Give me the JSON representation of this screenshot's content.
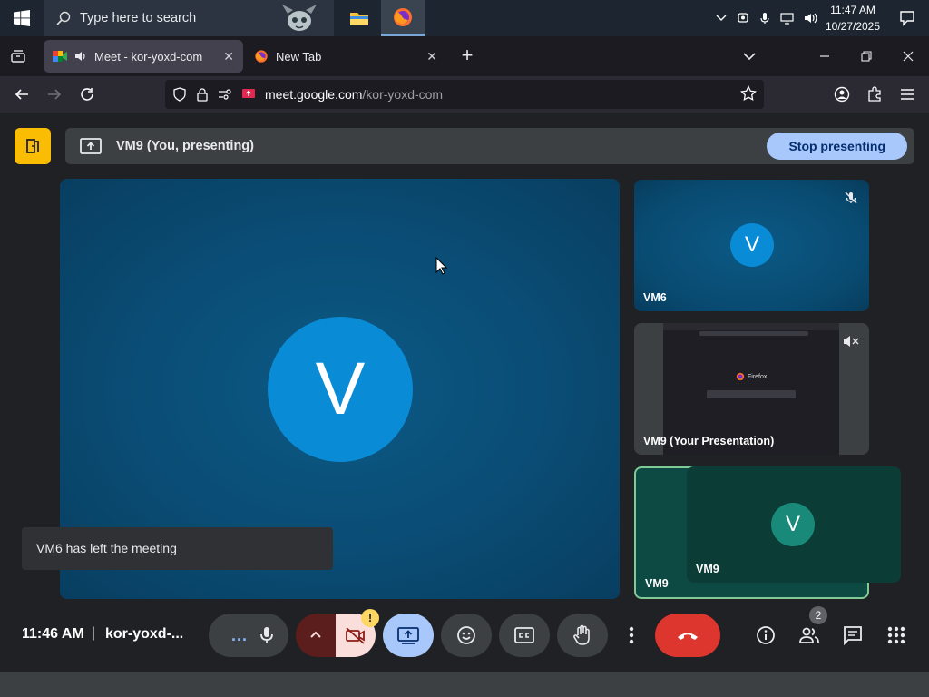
{
  "taskbar": {
    "search_placeholder": "Type here to search",
    "clock_time": "11:47 AM",
    "clock_date": "10/27/2025"
  },
  "browser": {
    "tabs": [
      {
        "title": "Meet - kor-yoxd-com",
        "active": true
      },
      {
        "title": "New Tab",
        "active": false
      }
    ],
    "url_host": "meet.google.com",
    "url_path": "/kor-yoxd-com"
  },
  "meet": {
    "banner_text": "VM9 (You, presenting)",
    "stop_presenting_label": "Stop presenting",
    "main_avatar_letter": "V",
    "tiles": [
      {
        "name": "VM6",
        "avatar": "V",
        "muted": true
      },
      {
        "name": "VM9 (Your Presentation)",
        "muted": true
      },
      {
        "name": "VM9",
        "avatar": "V"
      }
    ],
    "self_overlay_name": "VM9",
    "self_overlay_avatar": "V",
    "presentation_thumb_text": "Firefox",
    "toast": "VM6 has left the meeting",
    "time": "11:46 AM",
    "separator": "|",
    "meeting_code": "kor-yoxd-...",
    "people_count": "2",
    "camera_warning": "!",
    "more_options_label": "..."
  },
  "colors": {
    "accent_blue": "#a8c7fa",
    "leave_red": "#dc362e",
    "avatar_blue": "#0a8bd6",
    "self_green": "#198a7a",
    "meet_yellow": "#fbbc04"
  }
}
